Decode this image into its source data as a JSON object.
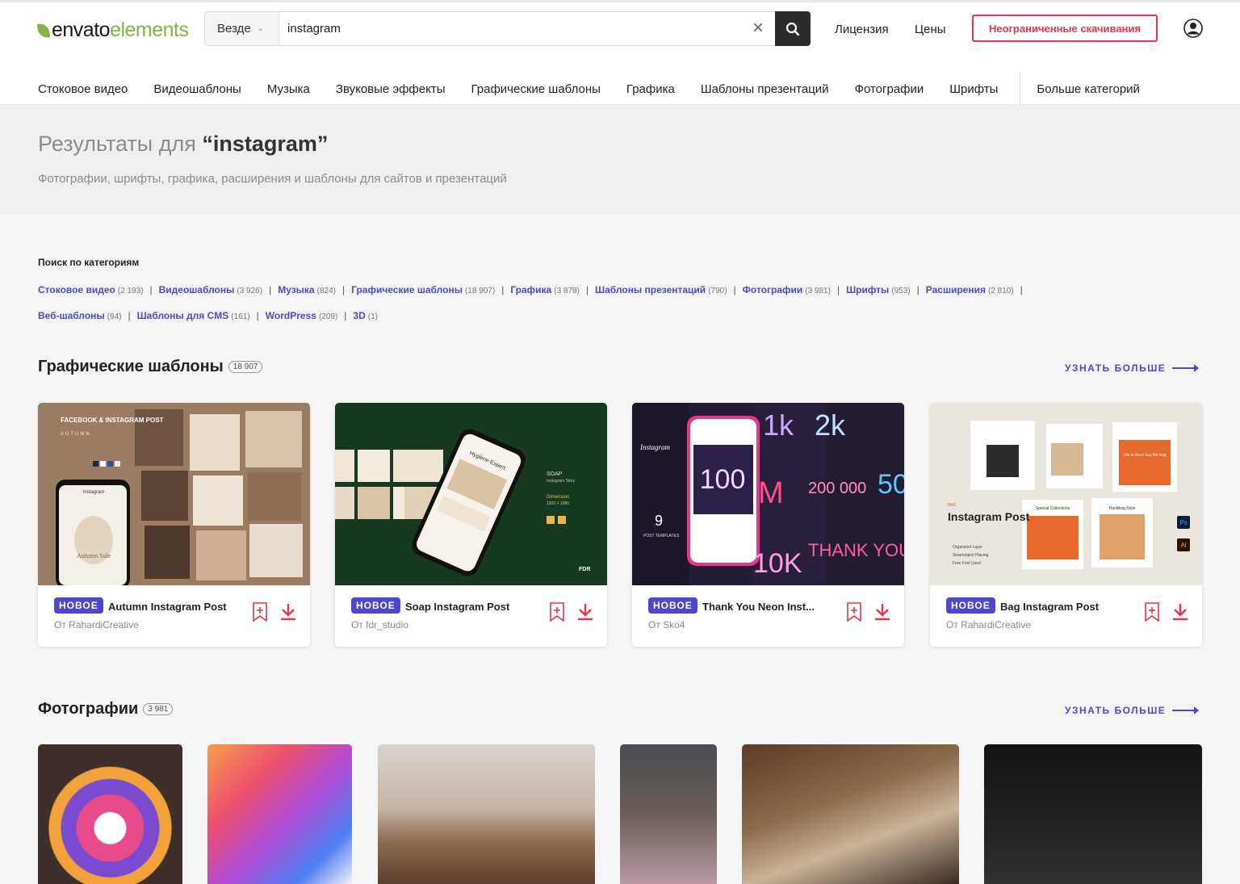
{
  "brand": {
    "name_a": "envato",
    "name_b": "elements",
    "accent": "#82b541"
  },
  "search": {
    "scope": "Везде",
    "value": "instagram",
    "placeholder": ""
  },
  "header": {
    "license": "Лицензия",
    "prices": "Цены",
    "cta": "Неограниченные скачивания",
    "cta_color": "#e8344c"
  },
  "nav": [
    "Стоковое видео",
    "Видеошаблоны",
    "Музыка",
    "Звуковые эффекты",
    "Графические шаблоны",
    "Графика",
    "Шаблоны презентаций",
    "Фотографии",
    "Шрифты"
  ],
  "nav_more": "Больше категорий",
  "results": {
    "prefix": "Результаты для",
    "query": "“instagram”",
    "subtitle": "Фотографии, шрифты, графика, расширения и шаблоны для сайтов и презентаций"
  },
  "categories": {
    "title": "Поиск по категориям",
    "items": [
      {
        "label": "Стоковое видео",
        "count": "(2 193)"
      },
      {
        "label": "Видеошаблоны",
        "count": "(3 926)"
      },
      {
        "label": "Музыка",
        "count": "(824)"
      },
      {
        "label": "Графические шаблоны",
        "count": "(18 907)"
      },
      {
        "label": "Графика",
        "count": "(3 878)"
      },
      {
        "label": "Шаблоны презентаций",
        "count": "(790)"
      },
      {
        "label": "Фотографии",
        "count": "(3 981)"
      },
      {
        "label": "Шрифты",
        "count": "(953)"
      },
      {
        "label": "Расширения",
        "count": "(2 810)"
      },
      {
        "label": "Веб-шаблоны",
        "count": "(94)"
      },
      {
        "label": "Шаблоны для CMS",
        "count": "(161)"
      },
      {
        "label": "WordPress",
        "count": "(209)"
      },
      {
        "label": "3D",
        "count": "(1)"
      }
    ]
  },
  "sections": {
    "graphics": {
      "title": "Графические шаблоны",
      "count": "18 907",
      "more": "УЗНАТЬ БОЛЬШЕ"
    },
    "photos": {
      "title": "Фотографии",
      "count": "3 981",
      "more": "УЗНАТЬ БОЛЬШЕ"
    }
  },
  "cards": [
    {
      "badge": "НОВОЕ",
      "title": "Autumn Instagram Post",
      "author": "От RahardiCreative"
    },
    {
      "badge": "НОВОЕ",
      "title": "Soap Instagram Post",
      "author": "От fdr_studio"
    },
    {
      "badge": "НОВОЕ",
      "title": "Thank You Neon Inst...",
      "author": "От Sko4"
    },
    {
      "badge": "НОВОЕ",
      "title": "Bag Instagram Post",
      "author": "От RahardiCreative"
    }
  ],
  "thumbs": {
    "autumn": {
      "heading": "FACEBOOK & INSTAGRAM POST",
      "sub": "AUTUMN",
      "sale": "Autumn Sale"
    },
    "soap": {
      "app": "Instagram",
      "label": "SOAP",
      "sub": "Instagram Story",
      "dim": "Dimension",
      "size": "1920 × 1080",
      "fdr": "FDR",
      "screen": "Hygiene Expert"
    },
    "neon": {
      "brand": "Instagram",
      "n1": "1k",
      "n2": "2k",
      "n3": "100",
      "n4": "200 000",
      "n5": "THANK YOU",
      "n6": "M",
      "n7": "50",
      "n8": "10K",
      "templates": "9",
      "templates_label": "POST TEMPLATES"
    },
    "bag": {
      "heading": "Instagram Post",
      "pre": "BAG",
      "f1": "Organized Layer",
      "f2": "Smartobject Placing",
      "f3": "Free Font Used",
      "ps": "Ps",
      "ai": "Ai",
      "hb": "Handbag Style",
      "spec": "Special Collections",
      "life": "Life is short buy the bag"
    }
  },
  "icons": {
    "clear": "close-icon",
    "search": "search-icon",
    "user": "user-icon",
    "bookmark": "bookmark-add-icon",
    "download": "download-icon"
  },
  "colors": {
    "link": "#4d46cf",
    "badge": "#4d46cf",
    "action": "#e8344c"
  }
}
